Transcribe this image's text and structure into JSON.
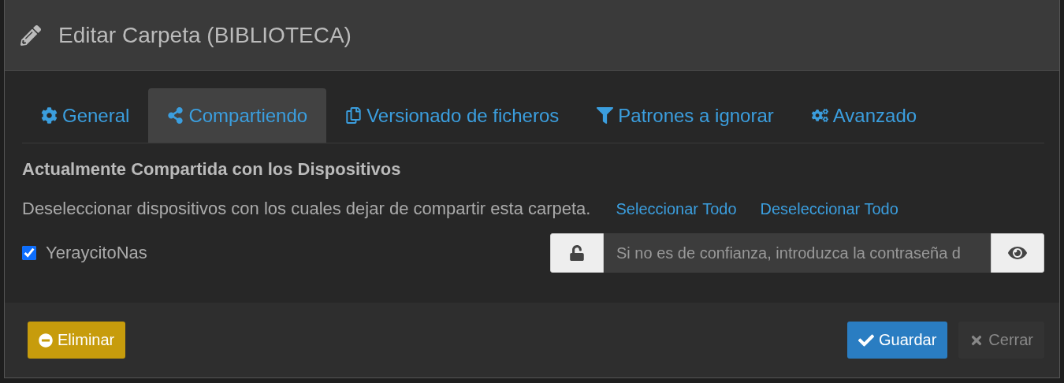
{
  "dialog": {
    "title": "Editar Carpeta (BIBLIOTECA)"
  },
  "tabs": [
    {
      "label": "General",
      "selected": false
    },
    {
      "label": "Compartiendo",
      "selected": true
    },
    {
      "label": "Versionado de ficheros",
      "selected": false
    },
    {
      "label": "Patrones a ignorar",
      "selected": false
    },
    {
      "label": "Avanzado",
      "selected": false
    }
  ],
  "sharing": {
    "heading": "Actualmente Compartida con los Dispositivos",
    "description": "Deseleccionar dispositivos con los cuales dejar de compartir esta carpeta.",
    "links": [
      "Seleccionar Todo",
      "Deseleccionar Todo"
    ],
    "devices": [
      {
        "name": "YeraycitoNas",
        "checked": true,
        "password_placeholder": "Si no es de confianza, introduzca la contraseña d"
      }
    ]
  },
  "footer": {
    "delete_button": "Eliminar",
    "save_button": "Guardar",
    "close_button": "Cerrar"
  }
}
